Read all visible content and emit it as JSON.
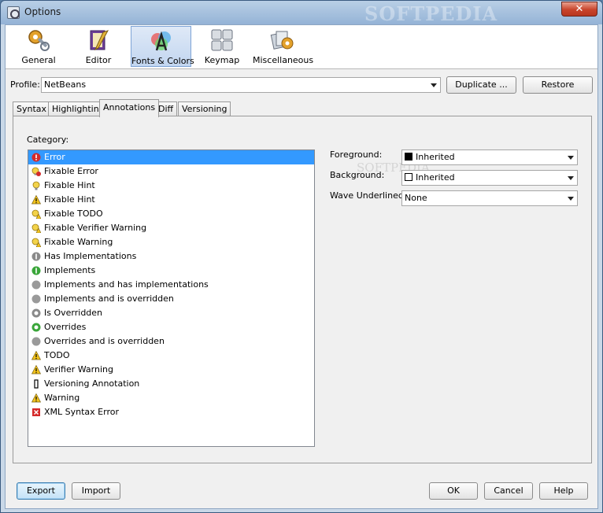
{
  "window": {
    "title": "Options",
    "watermark": "SOFTPEDIA"
  },
  "toolbar": {
    "items": [
      {
        "label": "General"
      },
      {
        "label": "Editor"
      },
      {
        "label": "Fonts & Colors"
      },
      {
        "label": "Keymap"
      },
      {
        "label": "Miscellaneous"
      }
    ]
  },
  "profile": {
    "label": "Profile:",
    "value": "NetBeans",
    "duplicate_label": "Duplicate ...",
    "restore_label": "Restore"
  },
  "tabs": [
    {
      "label": "Syntax"
    },
    {
      "label": "Highlighting"
    },
    {
      "label": "Annotations",
      "selected": true
    },
    {
      "label": "Diff"
    },
    {
      "label": "Versioning"
    }
  ],
  "category": {
    "label": "Category:",
    "items": [
      {
        "label": "Error",
        "icon": "error-icon"
      },
      {
        "label": "Fixable Error",
        "icon": "bulb-error-icon"
      },
      {
        "label": "Fixable Hint",
        "icon": "bulb-icon"
      },
      {
        "label": "Fixable Hint",
        "icon": "warning-icon"
      },
      {
        "label": "Fixable TODO",
        "icon": "bulb-warning-icon"
      },
      {
        "label": "Fixable Verifier Warning",
        "icon": "bulb-warning-icon"
      },
      {
        "label": "Fixable Warning",
        "icon": "bulb-warning-icon"
      },
      {
        "label": "Has Implementations",
        "icon": "has-implementations-icon"
      },
      {
        "label": "Implements",
        "icon": "implements-icon"
      },
      {
        "label": "Implements and has implementations",
        "icon": "gray-circle-icon"
      },
      {
        "label": "Implements and is overridden",
        "icon": "gray-circle-icon"
      },
      {
        "label": "Is Overridden",
        "icon": "is-overridden-icon"
      },
      {
        "label": "Overrides",
        "icon": "overrides-icon"
      },
      {
        "label": "Overrides and is overridden",
        "icon": "gray-circle-icon"
      },
      {
        "label": "TODO",
        "icon": "warning-icon"
      },
      {
        "label": "Verifier Warning",
        "icon": "warning-icon"
      },
      {
        "label": "Versioning Annotation",
        "icon": "bar-icon"
      },
      {
        "label": "Warning",
        "icon": "warning-icon"
      },
      {
        "label": "XML Syntax Error",
        "icon": "xml-error-icon"
      }
    ]
  },
  "properties": {
    "foreground_label": "Foreground:",
    "foreground_value": "Inherited",
    "foreground_color": "#000000",
    "background_label": "Background:",
    "background_value": "Inherited",
    "background_color": "#ffffff",
    "wave_label": "Wave Underlined:",
    "wave_value": "None"
  },
  "footer": {
    "export_label": "Export",
    "import_label": "Import",
    "ok_label": "OK",
    "cancel_label": "Cancel",
    "help_label": "Help"
  },
  "colors": {
    "selection": "#3399ff",
    "active_tool": "#c2d6f0"
  }
}
